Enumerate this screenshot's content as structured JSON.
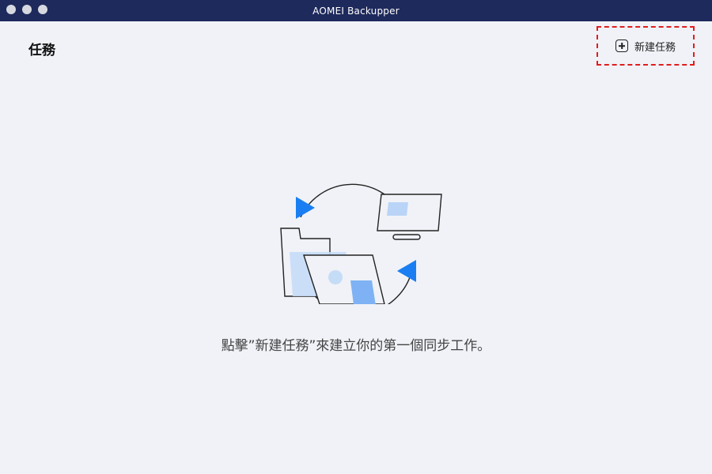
{
  "window": {
    "title": "AOMEI Backupper"
  },
  "header": {
    "page_title": "任務",
    "new_task_label": "新建任務"
  },
  "empty_state": {
    "hint": "點擊”新建任務”來建立你的第一個同步工作。"
  },
  "colors": {
    "titlebar": "#1e2a5c",
    "background": "#f0f2f7",
    "accent_blue": "#1a7ef2",
    "light_blue": "#b9d4f7",
    "highlight_border": "#e11d1d"
  }
}
